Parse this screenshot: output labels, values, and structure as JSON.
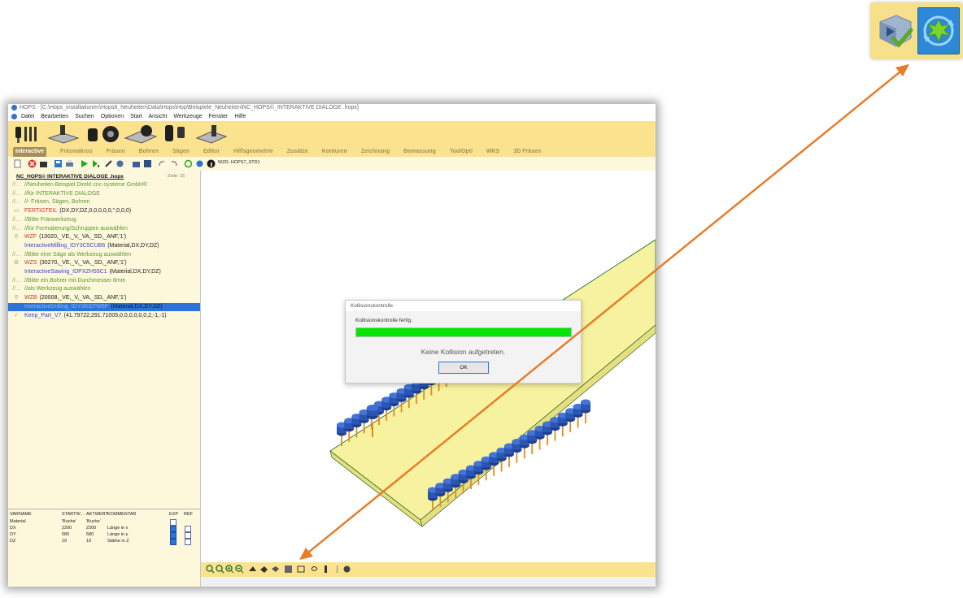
{
  "window": {
    "title": "HOPS - [C:\\Hops_installationen\\Hops8_Neuheiten\\Data\\Hops\\Hop\\Beispiele_Neuheiten\\NC_HOPS©_INTERAKTIVE DIALOGE .hopx]"
  },
  "menu": [
    "Datei",
    "Bearbeiten",
    "Suchen",
    "Optionen",
    "Start",
    "Ansicht",
    "Werkzeuge",
    "Fenster",
    "Hilfe"
  ],
  "tabs": [
    "Interactive",
    "Fräsmakros",
    "Fräsen",
    "Bohren",
    "Sägen",
    "Editor",
    "Hilfsgeometrie",
    "Zusätze",
    "Konturen",
    "Zeichnung",
    "Bemassung",
    "ToolOpti",
    "WKS",
    "3D Fräsen"
  ],
  "toolbar": {
    "tool_label": "WZG: HOPS7_STD1"
  },
  "file": {
    "name": "NC_HOPS© INTERAKTIVE DIALOGE .hopx",
    "lines": "Zeile: 15"
  },
  "code_lines": [
    {
      "gutter": "//...",
      "name": "//Neuheiten Beispiel Direkt cnc-systeme GmbH®",
      "args": "",
      "name_color": "green"
    },
    {
      "gutter": "//...",
      "name": "//für INTERAKTIVE DIALOGE",
      "args": "",
      "name_color": "green"
    },
    {
      "gutter": "//...",
      "name": "//- Fräsen, Sägen, Bohren",
      "args": "",
      "name_color": "green"
    },
    {
      "gutter": "▭",
      "name": "FERTIGTEIL",
      "args": "(DX,DY,DZ,0,0,0,0,0,'',0,0,0)",
      "name_color": "red"
    },
    {
      "gutter": "//...",
      "name": "//Bitte Fräswerkzeug",
      "args": "",
      "name_color": "green"
    },
    {
      "gutter": "//...",
      "name": "//für Formatierung/Schruppen auswählen",
      "args": "",
      "name_color": "green"
    },
    {
      "gutter": "⚲",
      "name": "WZF",
      "args": "(10020,_VE,_V,_VA,_SD,_ANF,'1')",
      "name_color": "red"
    },
    {
      "gutter": "",
      "name": "InteractiveMilling_IDY3C5CUB6",
      "args": "(Material,DX,DY,DZ)",
      "name_color": "blue"
    },
    {
      "gutter": "//...",
      "name": "//Bitte eine Säge als Werkzeug auswählen",
      "args": "",
      "name_color": "green"
    },
    {
      "gutter": "⚙",
      "name": "WZS",
      "args": "(30270,_VE,_V,_VA,_SD,_ANF,'1')",
      "name_color": "red"
    },
    {
      "gutter": "",
      "name": "InteractiveSawing_IDPXZH55C1",
      "args": "(Material,DX,DY,DZ)",
      "name_color": "blue"
    },
    {
      "gutter": "//...",
      "name": "//Bitte ein Bohrer mit Durchmesser 8mm",
      "args": "",
      "name_color": "green"
    },
    {
      "gutter": "//...",
      "name": "//als Werkzeug auswählen",
      "args": "",
      "name_color": "green"
    },
    {
      "gutter": "⚲",
      "name": "WZB",
      "args": "(20008,_VE,_V,_VA,_SD,_ANF,'1')",
      "name_color": "red"
    },
    {
      "gutter": "",
      "name": "InteractiveDrilling_IDYXKGTW5P",
      "args": "(Material,DX,DY,DZ)",
      "name_color": "blue",
      "selected": true
    },
    {
      "gutter": "✓",
      "name": "Keep_Part_V7",
      "args": "(41.79722,291.71005,0,0,0,0,0,0,2,-1,-1)",
      "name_color": "blue"
    }
  ],
  "variables": {
    "headers": [
      "VARNAME",
      "STARTW...",
      "AKTWERT",
      "KOMMENTAR",
      "EXP",
      "REF"
    ],
    "rows": [
      {
        "name": "Material",
        "start": "'Buche'",
        "akt": "'Buche'",
        "comment": "",
        "exp": false,
        "ref": null
      },
      {
        "name": "DX",
        "start": "2200",
        "akt": "2200",
        "comment": "Länge in x",
        "exp": true,
        "ref": false
      },
      {
        "name": "DY",
        "start": "580",
        "akt": "580",
        "comment": "Länge in y",
        "exp": true,
        "ref": false
      },
      {
        "name": "DZ",
        "start": "19",
        "akt": "19",
        "comment": "Stärke in Z",
        "exp": true,
        "ref": false
      }
    ]
  },
  "dialog": {
    "title": "Kollisionskontrolle",
    "message": "Kollisionskontrolle fertig.",
    "progress": 1.0,
    "result": "Keine Kollision aufgetreten.",
    "ok_label": "OK"
  },
  "colors": {
    "ribbon": "#fbe28f",
    "panel": "#fdf7dc",
    "selection": "#2c74d8",
    "progress": "#06e506",
    "arrow": "#e77c2a"
  }
}
